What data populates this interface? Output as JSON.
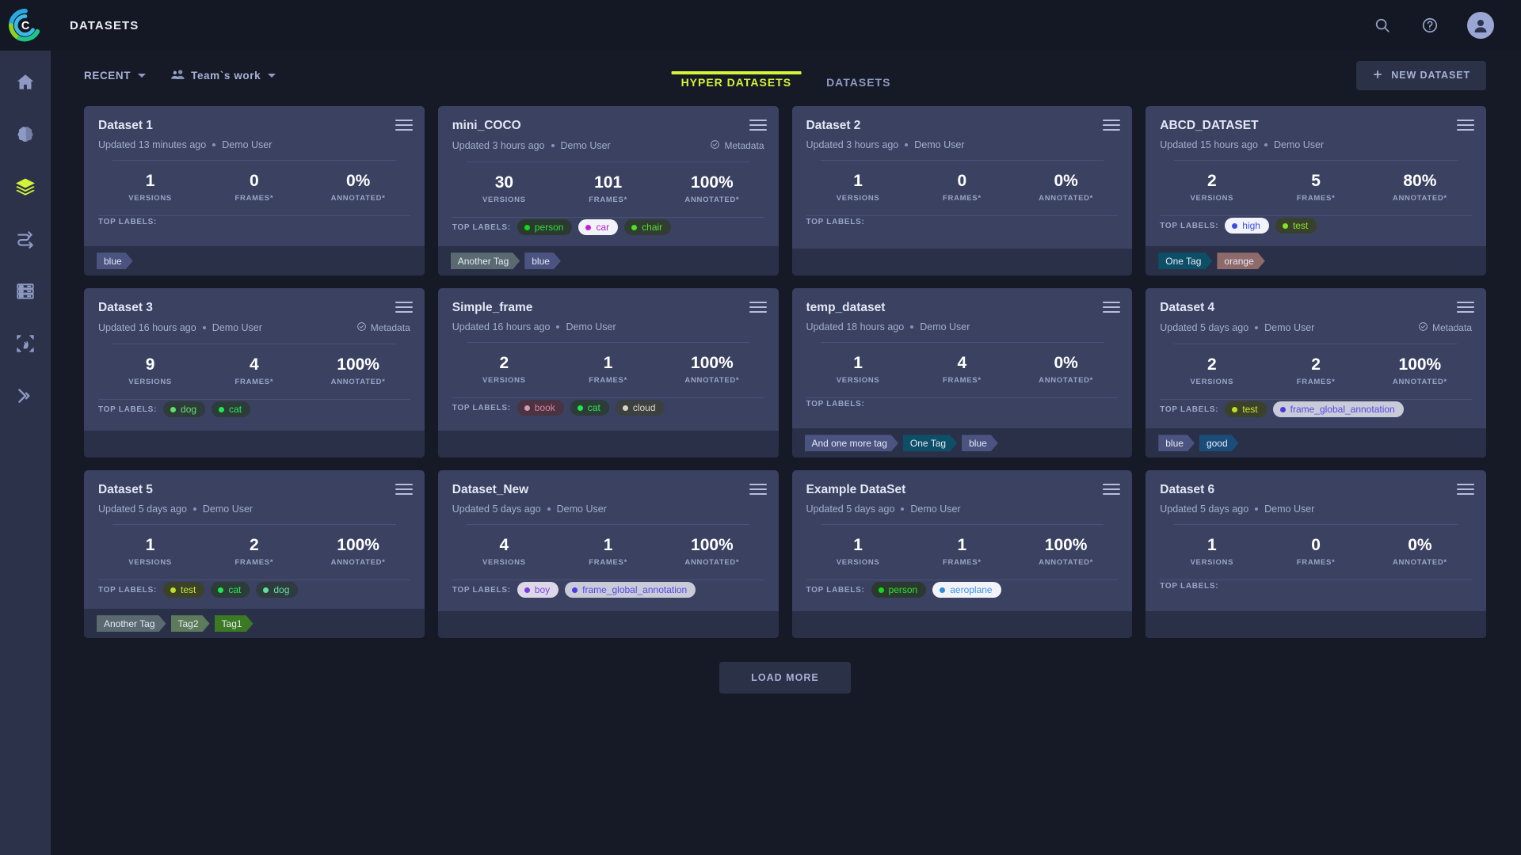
{
  "header": {
    "title": "DATASETS",
    "logo_name": "brand-logo",
    "icons": [
      {
        "name": "search-icon",
        "label": "Search"
      },
      {
        "name": "help-icon",
        "label": "Help"
      },
      {
        "name": "user-avatar-icon",
        "label": "Account"
      }
    ]
  },
  "sidebar": {
    "items": [
      {
        "name": "home-icon",
        "label": "Home",
        "active": false
      },
      {
        "name": "brain-icon",
        "label": "Models",
        "active": false
      },
      {
        "name": "layers-icon",
        "label": "Datasets",
        "active": true
      },
      {
        "name": "pipeline-icon",
        "label": "Pipelines",
        "active": false
      },
      {
        "name": "server-icon",
        "label": "Compute",
        "active": false
      },
      {
        "name": "annotation-icon",
        "label": "Annotations",
        "active": false
      },
      {
        "name": "chevrons-right-icon",
        "label": "Deploy",
        "active": false
      }
    ]
  },
  "toolbar": {
    "sort_filter": "RECENT",
    "scope_filter": "Team`s work",
    "new_dataset_label": "NEW DATASET",
    "plus_icon": "plus-icon",
    "tabs": [
      {
        "label": "HYPER DATASETS",
        "active": true
      },
      {
        "label": "DATASETS",
        "active": false
      }
    ]
  },
  "card_labels": {
    "versions": "VERSIONS",
    "frames": "FRAMES*",
    "annotated": "ANNOTATED*",
    "top_labels_caption": "TOP LABELS:",
    "metadata_badge": "Metadata"
  },
  "colors": {
    "accent": "#d4f536",
    "card_bg": "#3a4161",
    "tag_row_bg": "#2a3048",
    "page_bg": "#161a26",
    "sidebar_bg": "#2c3249",
    "topbar_bg": "#141824"
  },
  "footer": {
    "load_more_label": "LOAD MORE"
  },
  "cards": [
    {
      "title": "Dataset 1",
      "updated": "Updated 13 minutes ago",
      "user": "Demo User",
      "has_metadata": false,
      "versions": "1",
      "frames": "0",
      "annotated": "0%",
      "labels": [],
      "tags": [
        {
          "text": "blue",
          "bg": "#4b5480",
          "fg": "#e6eaf5"
        }
      ]
    },
    {
      "title": "mini_COCO",
      "updated": "Updated 3 hours ago",
      "user": "Demo User",
      "has_metadata": true,
      "versions": "30",
      "frames": "101",
      "annotated": "100%",
      "labels": [
        {
          "text": "person",
          "dot": "#16d916",
          "fg": "#2fe02f",
          "bg": "#2b3a30"
        },
        {
          "text": "car",
          "dot": "#c61fd6",
          "fg": "#b51fc7",
          "bg": "#f2f3f8"
        },
        {
          "text": "chair",
          "dot": "#4ce01e",
          "fg": "#5ae02a",
          "bg": "#313d33"
        }
      ],
      "tags": [
        {
          "text": "Another Tag",
          "bg": "#5a6a70",
          "fg": "#e6eaf5"
        },
        {
          "text": "blue",
          "bg": "#4b5480",
          "fg": "#e6eaf5"
        }
      ]
    },
    {
      "title": "Dataset 2",
      "updated": "Updated 3 hours ago",
      "user": "Demo User",
      "has_metadata": false,
      "versions": "1",
      "frames": "0",
      "annotated": "0%",
      "labels": [],
      "tags": []
    },
    {
      "title": "ABCD_DATASET",
      "updated": "Updated 15 hours ago",
      "user": "Demo User",
      "has_metadata": false,
      "versions": "2",
      "frames": "5",
      "annotated": "80%",
      "labels": [
        {
          "text": "high",
          "dot": "#3a4fe0",
          "fg": "#3f52e6",
          "bg": "#f2f3f8"
        },
        {
          "text": "test",
          "dot": "#86e024",
          "fg": "#8fe030",
          "bg": "#38412c"
        }
      ],
      "tags": [
        {
          "text": "One Tag",
          "bg": "#0d4f66",
          "fg": "#e6eaf5"
        },
        {
          "text": "orange",
          "bg": "#8f6a6a",
          "fg": "#e6eaf5"
        }
      ]
    },
    {
      "title": "Dataset 3",
      "updated": "Updated 16 hours ago",
      "user": "Demo User",
      "has_metadata": true,
      "versions": "9",
      "frames": "4",
      "annotated": "100%",
      "labels": [
        {
          "text": "dog",
          "dot": "#5ee06e",
          "fg": "#63e070",
          "bg": "#2e3c3a"
        },
        {
          "text": "cat",
          "dot": "#1ee84e",
          "fg": "#27ea52",
          "bg": "#2c3c38"
        }
      ],
      "tags": []
    },
    {
      "title": "Simple_frame",
      "updated": "Updated 16 hours ago",
      "user": "Demo User",
      "has_metadata": false,
      "versions": "2",
      "frames": "1",
      "annotated": "100%",
      "labels": [
        {
          "text": "book",
          "dot": "#d49ab0",
          "fg": "#e07fa0",
          "bg": "#4a3342"
        },
        {
          "text": "cat",
          "dot": "#1ee84e",
          "fg": "#27ea52",
          "bg": "#2c3c38"
        },
        {
          "text": "cloud",
          "dot": "#d8d4c0",
          "fg": "#dcd8c6",
          "bg": "#3d4040"
        }
      ],
      "tags": []
    },
    {
      "title": "temp_dataset",
      "updated": "Updated 18 hours ago",
      "user": "Demo User",
      "has_metadata": false,
      "versions": "1",
      "frames": "4",
      "annotated": "0%",
      "labels": [],
      "tags": [
        {
          "text": "And one more tag",
          "bg": "#4b5480",
          "fg": "#e6eaf5"
        },
        {
          "text": "One Tag",
          "bg": "#0d4f66",
          "fg": "#e6eaf5"
        },
        {
          "text": "blue",
          "bg": "#4b5480",
          "fg": "#e6eaf5"
        }
      ]
    },
    {
      "title": "Dataset 4",
      "updated": "Updated 5 days ago",
      "user": "Demo User",
      "has_metadata": true,
      "versions": "2",
      "frames": "2",
      "annotated": "100%",
      "labels": [
        {
          "text": "test",
          "dot": "#b9e024",
          "fg": "#c3e635",
          "bg": "#3c4229"
        },
        {
          "text": "frame_global_annotation",
          "dot": "#4a3ae0",
          "fg": "#5546e6",
          "bg": "#c9ccd8"
        }
      ],
      "tags": [
        {
          "text": "blue",
          "bg": "#4b5480",
          "fg": "#e6eaf5"
        },
        {
          "text": "good",
          "bg": "#1a4d7a",
          "fg": "#e6eaf5"
        }
      ]
    },
    {
      "title": "Dataset 5",
      "updated": "Updated 5 days ago",
      "user": "Demo User",
      "has_metadata": false,
      "versions": "1",
      "frames": "2",
      "annotated": "100%",
      "labels": [
        {
          "text": "test",
          "dot": "#b9e024",
          "fg": "#c3e635",
          "bg": "#3c4229"
        },
        {
          "text": "cat",
          "dot": "#1ee84e",
          "fg": "#27ea52",
          "bg": "#2c3c38"
        },
        {
          "text": "dog",
          "dot": "#5ee0a0",
          "fg": "#63e0a6",
          "bg": "#2e3c3e"
        }
      ],
      "tags": [
        {
          "text": "Another Tag",
          "bg": "#5a6a70",
          "fg": "#e6eaf5"
        },
        {
          "text": "Tag2",
          "bg": "#5d7a5a",
          "fg": "#e6eaf5"
        },
        {
          "text": "Tag1",
          "bg": "#3b7a22",
          "fg": "#e6eaf5"
        }
      ]
    },
    {
      "title": "Dataset_New",
      "updated": "Updated 5 days ago",
      "user": "Demo User",
      "has_metadata": false,
      "versions": "4",
      "frames": "1",
      "annotated": "100%",
      "labels": [
        {
          "text": "boy",
          "dot": "#7a3ae0",
          "fg": "#8046e6",
          "bg": "#dcd8e8"
        },
        {
          "text": "frame_global_annotation",
          "dot": "#4a3ae0",
          "fg": "#5546e6",
          "bg": "#c9ccd8"
        }
      ],
      "tags": []
    },
    {
      "title": "Example DataSet",
      "updated": "Updated 5 days ago",
      "user": "Demo User",
      "has_metadata": false,
      "versions": "1",
      "frames": "1",
      "annotated": "100%",
      "labels": [
        {
          "text": "person",
          "dot": "#16d916",
          "fg": "#2fe02f",
          "bg": "#2b3a30"
        },
        {
          "text": "aeroplane",
          "dot": "#2f8ae0",
          "fg": "#3f95e6",
          "bg": "#f2f3f8"
        }
      ],
      "tags": []
    },
    {
      "title": "Dataset 6",
      "updated": "Updated 5 days ago",
      "user": "Demo User",
      "has_metadata": false,
      "versions": "1",
      "frames": "0",
      "annotated": "0%",
      "labels": [],
      "tags": []
    }
  ]
}
